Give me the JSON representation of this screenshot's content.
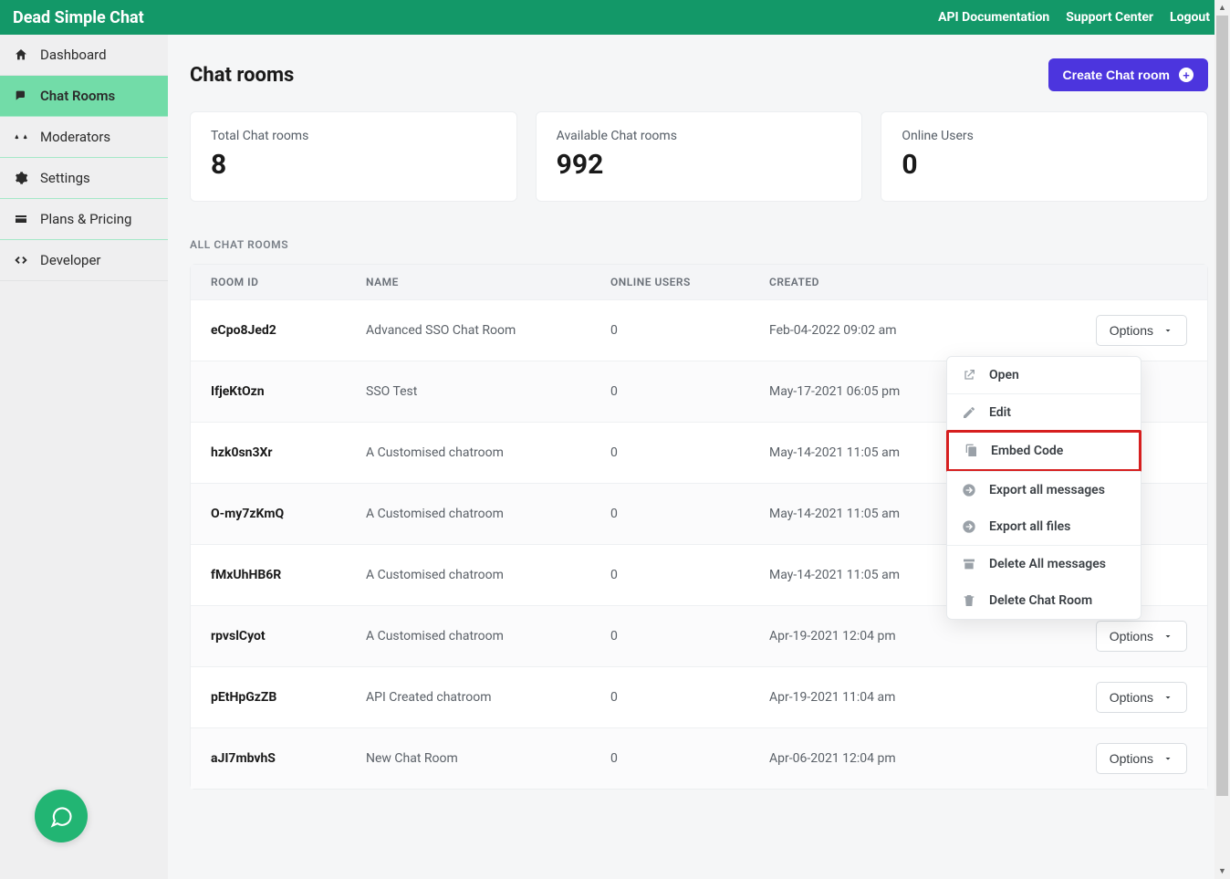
{
  "brand": "Dead Simple Chat",
  "topnav": {
    "api": "API Documentation",
    "support": "Support Center",
    "logout": "Logout"
  },
  "sidebar": {
    "items": [
      {
        "label": "Dashboard",
        "icon": "home"
      },
      {
        "label": "Chat Rooms",
        "icon": "comments"
      },
      {
        "label": "Moderators",
        "icon": "balance"
      },
      {
        "label": "Settings",
        "icon": "gear"
      },
      {
        "label": "Plans & Pricing",
        "icon": "card"
      },
      {
        "label": "Developer",
        "icon": "code"
      }
    ]
  },
  "page": {
    "title": "Chat rooms",
    "create_button": "Create Chat room"
  },
  "stats": {
    "total_label": "Total Chat rooms",
    "total_value": "8",
    "available_label": "Available Chat rooms",
    "available_value": "992",
    "online_label": "Online Users",
    "online_value": "0"
  },
  "section_label": "ALL CHAT ROOMS",
  "table": {
    "headers": {
      "room_id": "ROOM ID",
      "name": "NAME",
      "online": "ONLINE USERS",
      "created": "CREATED"
    },
    "options_label": "Options",
    "rows": [
      {
        "id": "eCpo8Jed2",
        "name": "Advanced SSO Chat Room",
        "online": "0",
        "created": "Feb-04-2022 09:02 am"
      },
      {
        "id": "IfjeKtOzn",
        "name": "SSO Test",
        "online": "0",
        "created": "May-17-2021 06:05 pm"
      },
      {
        "id": "hzk0sn3Xr",
        "name": "A Customised chatroom",
        "online": "0",
        "created": "May-14-2021 11:05 am"
      },
      {
        "id": "O-my7zKmQ",
        "name": "A Customised chatroom",
        "online": "0",
        "created": "May-14-2021 11:05 am"
      },
      {
        "id": "fMxUhHB6R",
        "name": "A Customised chatroom",
        "online": "0",
        "created": "May-14-2021 11:05 am"
      },
      {
        "id": "rpvslCyot",
        "name": "A Customised chatroom",
        "online": "0",
        "created": "Apr-19-2021 12:04 pm"
      },
      {
        "id": "pEtHpGzZB",
        "name": "API Created chatroom",
        "online": "0",
        "created": "Apr-19-2021 11:04 am"
      },
      {
        "id": "aJI7mbvhS",
        "name": "New Chat Room",
        "online": "0",
        "created": "Apr-06-2021 12:04 pm"
      }
    ]
  },
  "dropdown": {
    "open": "Open",
    "edit": "Edit",
    "embed": "Embed Code",
    "export_msgs": "Export all messages",
    "export_files": "Export all files",
    "delete_msgs": "Delete All messages",
    "delete_room": "Delete Chat Room"
  }
}
